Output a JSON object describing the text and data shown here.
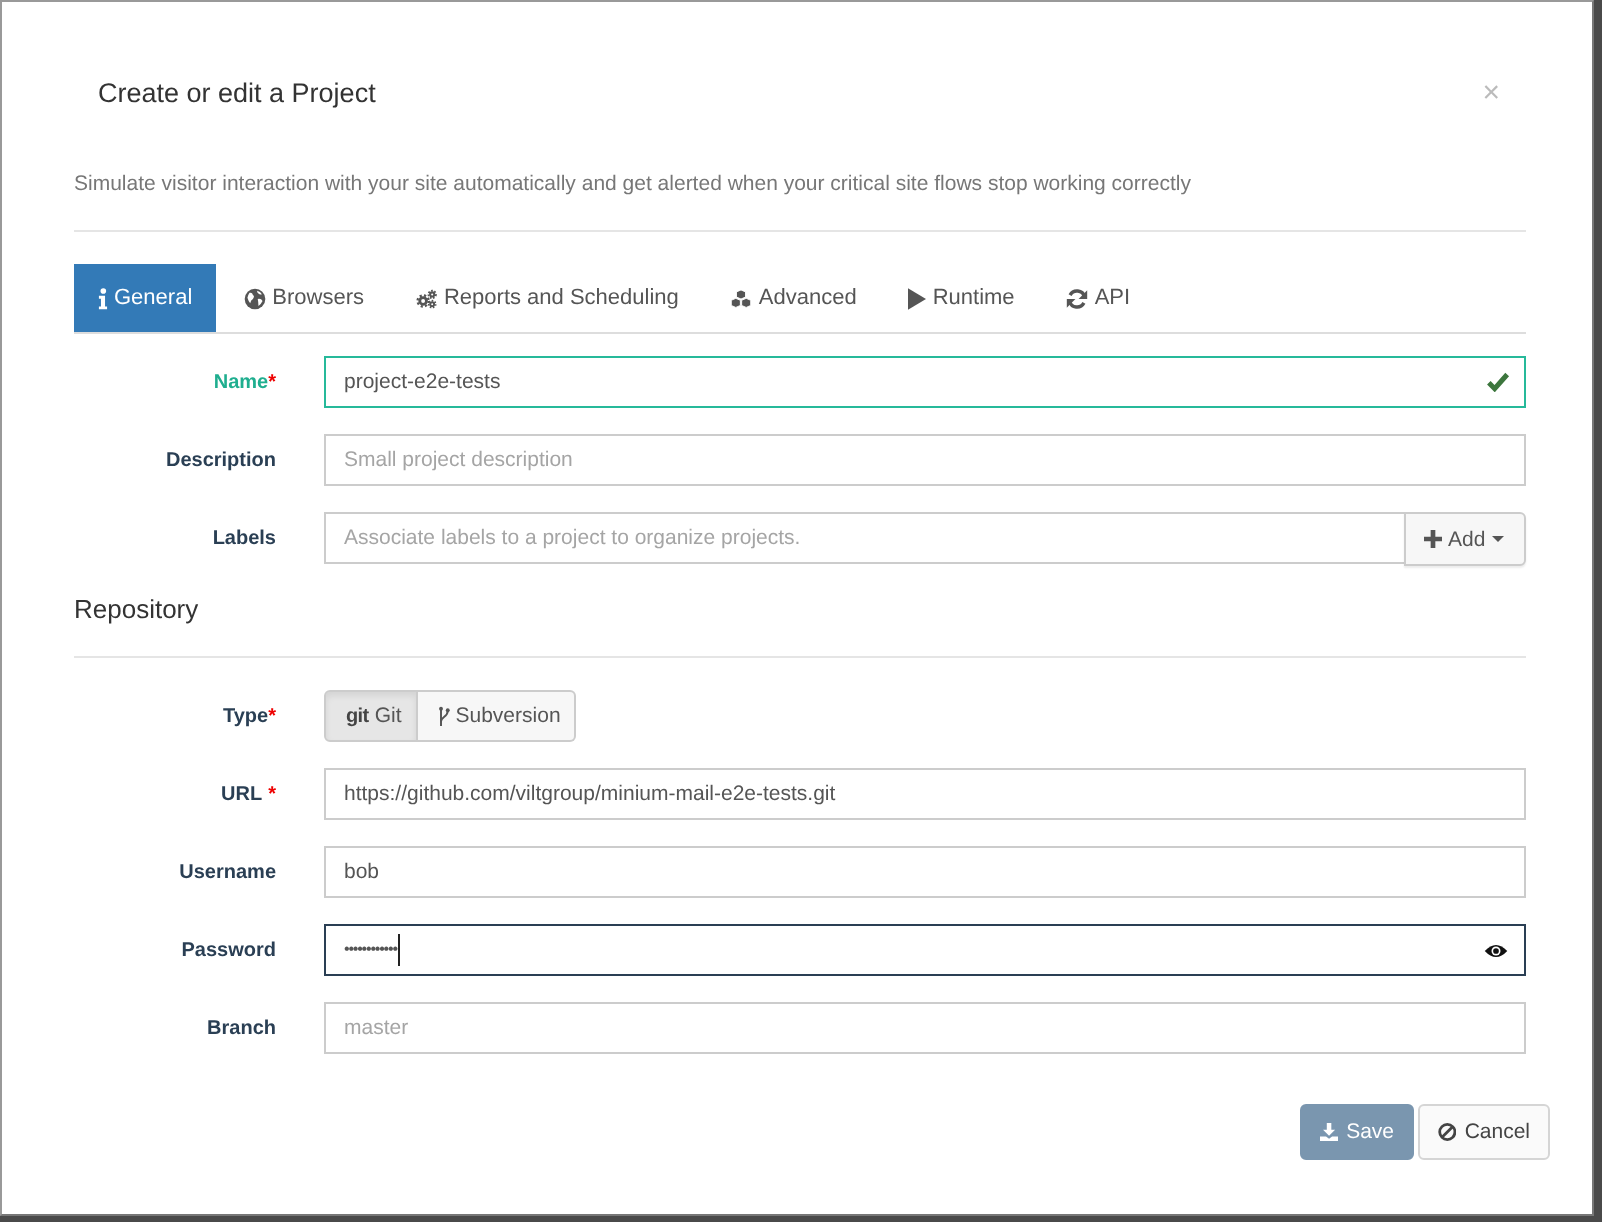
{
  "dialog": {
    "title": "Create or edit a Project",
    "close": "×",
    "subtitle": "Simulate visitor interaction with your site automatically and get alerted when your critical site flows stop working correctly"
  },
  "tabs": [
    {
      "label": "General",
      "selected": true
    },
    {
      "label": "Browsers",
      "selected": false
    },
    {
      "label": "Reports and Scheduling",
      "selected": false
    },
    {
      "label": "Advanced",
      "selected": false
    },
    {
      "label": "Runtime",
      "selected": false
    },
    {
      "label": "API",
      "selected": false
    }
  ],
  "general_fields": [
    {
      "label": "Name",
      "required_mark": "*",
      "value": "project-e2e-tests",
      "valid": true
    },
    {
      "label": "Description",
      "placeholder": "Small project description"
    },
    {
      "label": "Labels",
      "placeholder": "Associate labels to a project to organize projects.",
      "add_button": "Add"
    }
  ],
  "repository": {
    "title": "Repository",
    "type": {
      "label": "Type",
      "required_mark": "*",
      "options": [
        {
          "logo": "git",
          "label": "Git",
          "selected": true
        },
        {
          "label": "Subversion",
          "selected": false
        }
      ]
    },
    "fields": [
      {
        "label": "URL",
        "required_mark": "*",
        "kind": "text",
        "value": "https://github.com/viltgroup/minium-mail-e2e-tests.git"
      },
      {
        "label": "Username",
        "kind": "text",
        "value": "bob"
      },
      {
        "label": "Password",
        "kind": "password",
        "value": "••••••••••••",
        "focused": true
      },
      {
        "label": "Branch",
        "kind": "text",
        "placeholder": "master"
      }
    ]
  },
  "footer_buttons": [
    {
      "label": "Save",
      "kind": "primary",
      "disabled": true
    },
    {
      "label": "Cancel",
      "kind": "default",
      "disabled": false
    }
  ]
}
